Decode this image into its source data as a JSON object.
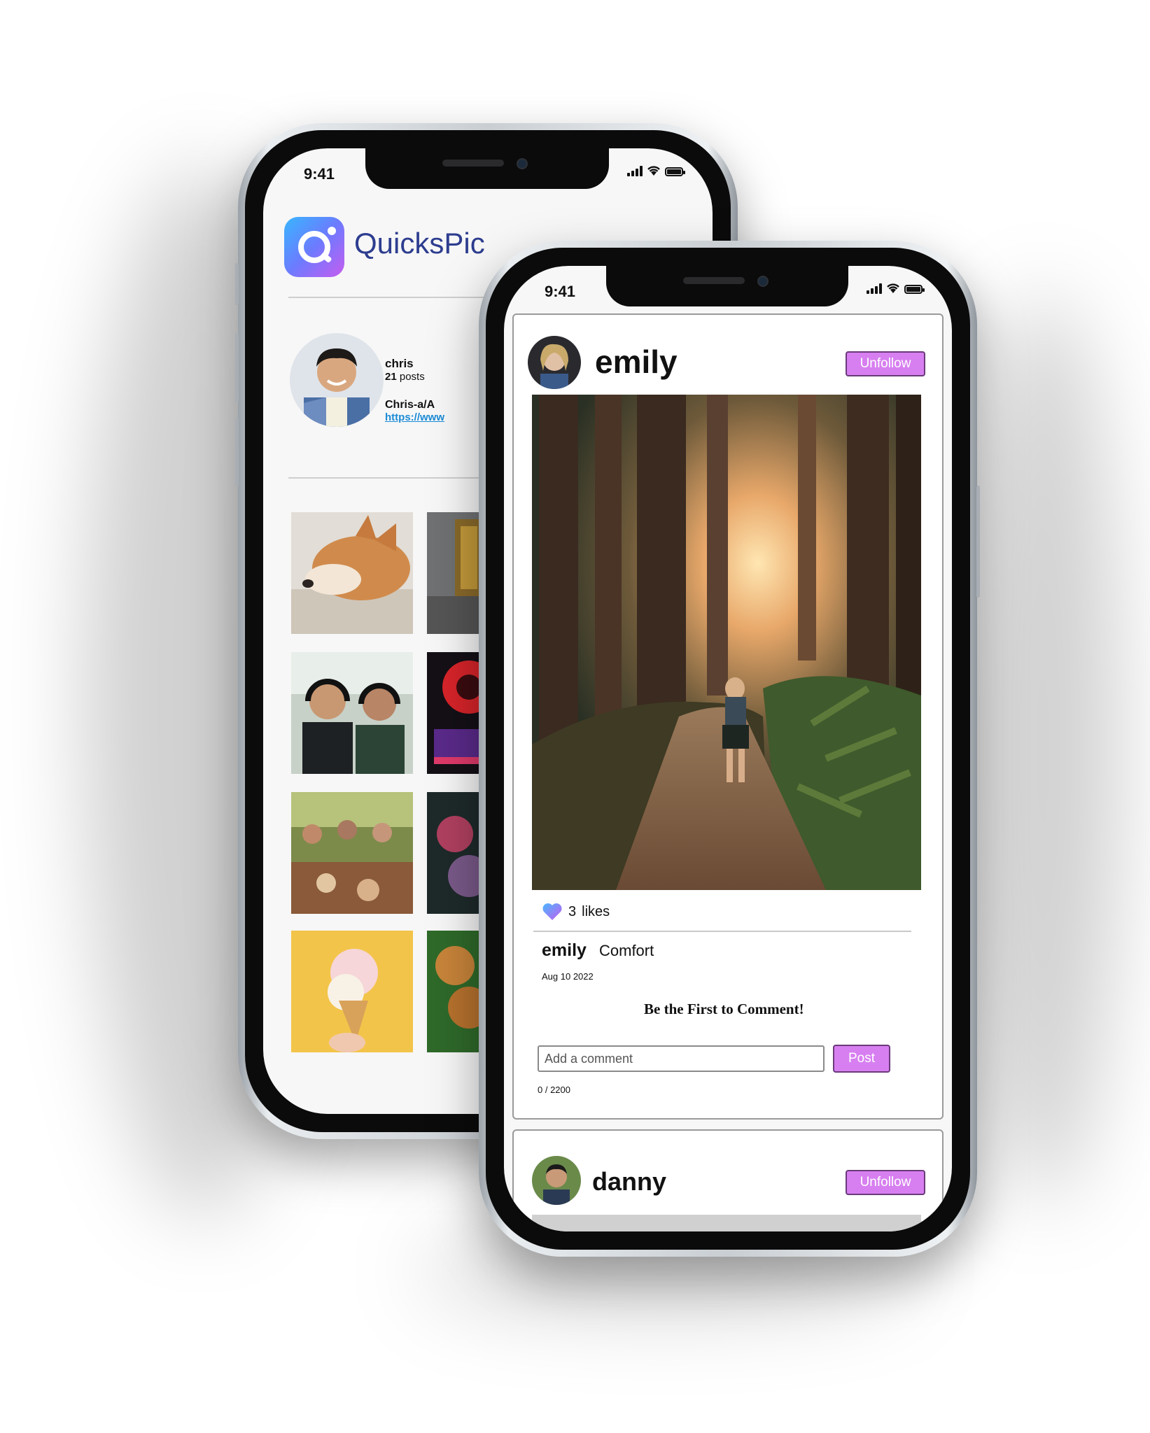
{
  "back_phone": {
    "status_time": "9:41",
    "app_name": "QuicksPic",
    "profile": {
      "username": "chris",
      "post_count": "21",
      "posts_label": "posts",
      "display_name": "Chris-a/A",
      "website": "https://www"
    },
    "grid_images": [
      "shiba-dog-sleeping",
      "bookshelf-detail",
      "friends-with-headphones",
      "gaming-pc-rgb",
      "outdoor-dinner-party",
      "flowers",
      "ice-cream-cone",
      "fried-chicken"
    ]
  },
  "front_phone": {
    "status_time": "9:41",
    "posts": [
      {
        "username": "emily",
        "follow_button": "Unfollow",
        "image": "forest-hiker",
        "likes_count": "3",
        "likes_label": "likes",
        "caption_user": "emily",
        "caption_text": "Comfort",
        "date": "Aug 10 2022",
        "comments_empty_text": "Be the First to Comment!",
        "comment_placeholder": "Add a comment",
        "post_button": "Post",
        "char_count": "0 / 2200"
      },
      {
        "username": "danny",
        "follow_button": "Unfollow"
      }
    ]
  },
  "colors": {
    "accent_button": "#d77ff0",
    "logo_text": "#2d3d8f",
    "link": "#1b8bd6"
  }
}
